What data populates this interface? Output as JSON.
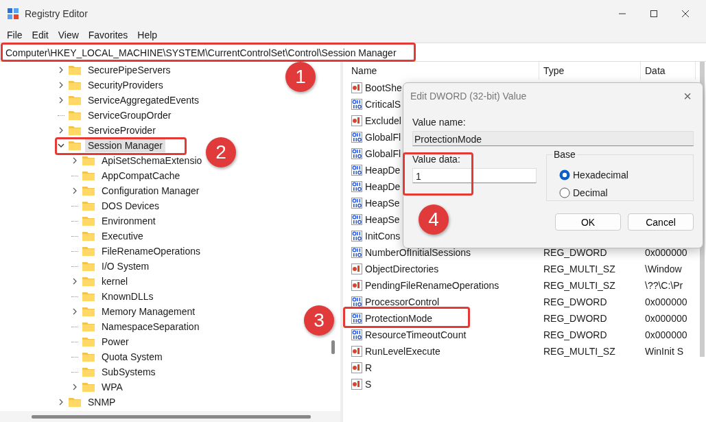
{
  "window": {
    "title": "Registry Editor"
  },
  "menu": [
    "File",
    "Edit",
    "View",
    "Favorites",
    "Help"
  ],
  "address": "Computer\\HKEY_LOCAL_MACHINE\\SYSTEM\\CurrentControlSet\\Control\\Session Manager",
  "tree": [
    {
      "label": "SecurePipeServers",
      "expandable": true,
      "expanded": false,
      "selected": false
    },
    {
      "label": "SecurityProviders",
      "expandable": true,
      "expanded": false,
      "selected": false
    },
    {
      "label": "ServiceAggregatedEvents",
      "expandable": true,
      "expanded": false,
      "selected": false
    },
    {
      "label": "ServiceGroupOrder",
      "expandable": false,
      "selected": false
    },
    {
      "label": "ServiceProvider",
      "expandable": true,
      "expanded": false,
      "selected": false
    },
    {
      "label": "Session Manager",
      "expandable": true,
      "expanded": true,
      "selected": true,
      "children": [
        {
          "label": "ApiSetSchemaExtensio",
          "expandable": true,
          "expanded": false,
          "selected": false
        },
        {
          "label": "AppCompatCache",
          "expandable": false,
          "selected": false
        },
        {
          "label": "Configuration Manager",
          "expandable": true,
          "expanded": false,
          "selected": false
        },
        {
          "label": "DOS Devices",
          "expandable": false,
          "selected": false
        },
        {
          "label": "Environment",
          "expandable": false,
          "selected": false
        },
        {
          "label": "Executive",
          "expandable": false,
          "selected": false
        },
        {
          "label": "FileRenameOperations",
          "expandable": false,
          "selected": false
        },
        {
          "label": "I/O System",
          "expandable": false,
          "selected": false
        },
        {
          "label": "kernel",
          "expandable": true,
          "expanded": false,
          "selected": false
        },
        {
          "label": "KnownDLLs",
          "expandable": false,
          "selected": false
        },
        {
          "label": "Memory Management",
          "expandable": true,
          "expanded": false,
          "selected": false
        },
        {
          "label": "NamespaceSeparation",
          "expandable": false,
          "selected": false
        },
        {
          "label": "Power",
          "expandable": false,
          "selected": false
        },
        {
          "label": "Quota System",
          "expandable": false,
          "selected": false
        },
        {
          "label": "SubSystems",
          "expandable": false,
          "selected": false
        },
        {
          "label": "WPA",
          "expandable": true,
          "expanded": false,
          "selected": false
        }
      ]
    },
    {
      "label": "SNMP",
      "expandable": true,
      "expanded": false,
      "selected": false
    }
  ],
  "list": {
    "columns": [
      "Name",
      "Type",
      "Data"
    ],
    "rows": [
      {
        "kind": "string",
        "name": "BootShe"
      },
      {
        "kind": "binary",
        "name": "CriticalS"
      },
      {
        "kind": "string",
        "name": "Excludel"
      },
      {
        "kind": "binary",
        "name": "GlobalFl"
      },
      {
        "kind": "binary",
        "name": "GlobalFl"
      },
      {
        "kind": "binary",
        "name": "HeapDe"
      },
      {
        "kind": "binary",
        "name": "HeapDe"
      },
      {
        "kind": "binary",
        "name": "HeapSe"
      },
      {
        "kind": "binary",
        "name": "HeapSe"
      },
      {
        "kind": "binary",
        "name": "InitCons"
      },
      {
        "kind": "binary",
        "name": "NumberOfInitialSessions",
        "type": "REG_DWORD",
        "data": "0x000000"
      },
      {
        "kind": "string",
        "name": "ObjectDirectories",
        "type": "REG_MULTI_SZ",
        "data": "\\Window"
      },
      {
        "kind": "string",
        "name": "PendingFileRenameOperations",
        "type": "REG_MULTI_SZ",
        "data": "\\??\\C:\\Pr"
      },
      {
        "kind": "binary",
        "name": "ProcessorControl",
        "type": "REG_DWORD",
        "data": "0x000000"
      },
      {
        "kind": "binary",
        "name": "ProtectionMode",
        "type": "REG_DWORD",
        "data": "0x000000"
      },
      {
        "kind": "binary",
        "name": "ResourceTimeoutCount",
        "type": "REG_DWORD",
        "data": "0x000000"
      },
      {
        "kind": "string",
        "name": "RunLevelExecute",
        "type": "REG_MULTI_SZ",
        "data": "WinInit S"
      },
      {
        "kind": "string",
        "name": "R"
      },
      {
        "kind": "string",
        "name": "S"
      }
    ]
  },
  "dialog": {
    "title": "Edit DWORD (32-bit) Value",
    "close": "×",
    "value_name_label": "Value name:",
    "value_name": "ProtectionMode",
    "value_data_label": "Value data:",
    "value_data": "1",
    "base_label": "Base",
    "bases": [
      {
        "label": "Hexadecimal",
        "selected": true
      },
      {
        "label": "Decimal",
        "selected": false
      }
    ],
    "buttons": [
      "OK",
      "Cancel"
    ]
  },
  "callouts": [
    {
      "number": "1"
    },
    {
      "number": "2"
    },
    {
      "number": "3"
    },
    {
      "number": "4"
    }
  ]
}
